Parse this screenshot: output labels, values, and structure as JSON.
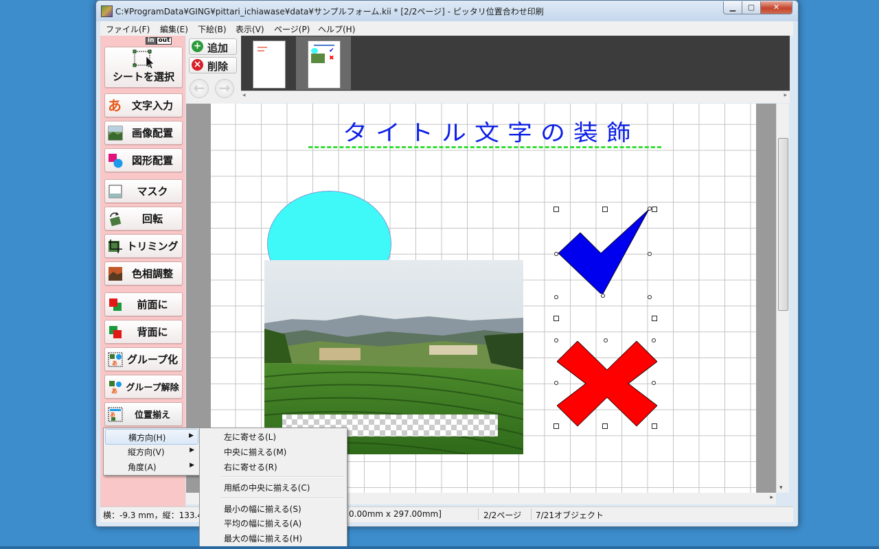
{
  "window": {
    "title": "C:¥ProgramData¥GING¥pittari_ichiawase¥data¥サンプルフォーム.kii *  [2/2ページ] - ピッタリ位置合わせ印刷"
  },
  "menubar": [
    {
      "label": "ファイル(F)"
    },
    {
      "label": "編集(E)"
    },
    {
      "label": "下絵(B)"
    },
    {
      "label": "表示(V)"
    },
    {
      "label": "ページ(P)"
    },
    {
      "label": "ヘルプ(H)"
    }
  ],
  "inout": {
    "in": "in",
    "out": "out"
  },
  "tools": [
    {
      "label": "シートを選択"
    },
    {
      "label": "文字入力"
    },
    {
      "label": "画像配置"
    },
    {
      "label": "図形配置"
    },
    {
      "label": "マスク"
    },
    {
      "label": "回転"
    },
    {
      "label": "トリミング"
    },
    {
      "label": "色相調整"
    },
    {
      "label": "前面に"
    },
    {
      "label": "背面に"
    },
    {
      "label": "グループ化"
    },
    {
      "label": "グループ解除"
    },
    {
      "label": "位置揃え"
    }
  ],
  "pagebuttons": {
    "add": "追加",
    "remove": "削除",
    "prev_icon": "arrow-left-icon",
    "next_icon": "arrow-right-icon"
  },
  "canvas": {
    "title_text": "タイトル文字の装飾",
    "colors": {
      "title": "#0a1ee6",
      "ellipse": "#3ff8f8",
      "check": "#0000ee",
      "cross": "#ff0000",
      "underline": "#33dd33"
    }
  },
  "status": {
    "coords": "横：-9.3 mm，縦：133.4",
    "paper": "0.00mm x 297.00mm]",
    "page": "2/2ページ",
    "objects": "7/21オブジェクト"
  },
  "context_menu": {
    "items": [
      {
        "label": "横方向(H)",
        "has_sub": true,
        "highlighted": true
      },
      {
        "label": "縦方向(V)",
        "has_sub": true
      },
      {
        "label": "角度(A)",
        "has_sub": true
      }
    ]
  },
  "submenu": {
    "items": [
      {
        "label": "左に寄せる(L)"
      },
      {
        "label": "中央に揃える(M)"
      },
      {
        "label": "右に寄せる(R)"
      },
      {
        "label": "用紙の中央に揃える(C)"
      },
      {
        "label": "最小の幅に揃える(S)"
      },
      {
        "label": "平均の幅に揃える(A)"
      },
      {
        "label": "最大の幅に揃える(H)"
      }
    ]
  }
}
